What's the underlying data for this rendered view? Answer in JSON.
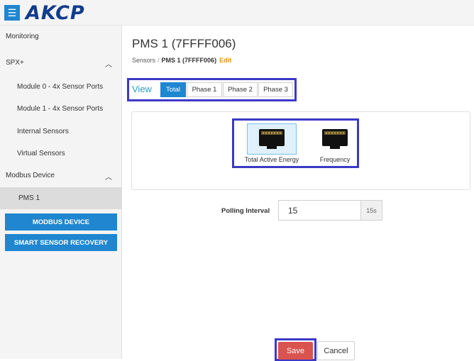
{
  "brand": {
    "logo": "AKCP",
    "menu_icon": "hamburger-icon",
    "accent": "#1f86cf"
  },
  "sidebar": {
    "items": [
      {
        "label": "Monitoring"
      },
      {
        "label": "SPX+",
        "chevron": "chevron-up-icon"
      },
      {
        "label": "Module 0 - 4x Sensor Ports"
      },
      {
        "label": "Module 1 - 4x Sensor Ports"
      },
      {
        "label": "Internal Sensors"
      },
      {
        "label": "Virtual Sensors"
      },
      {
        "label": "Modbus Device",
        "chevron": "chevron-up-icon"
      },
      {
        "label": "PMS 1"
      }
    ],
    "buttons": {
      "modbus": "MODBUS DEVICE",
      "recovery": "SMART SENSOR RECOVERY"
    }
  },
  "page": {
    "title": "PMS 1 (7FFFF006)",
    "breadcrumb": {
      "root": "Sensors",
      "sep": "/",
      "current": "PMS 1 (7FFFF006)",
      "edit": "Edit"
    }
  },
  "view": {
    "label": "View",
    "tabs": [
      {
        "label": "Total",
        "active": true
      },
      {
        "label": "Phase 1"
      },
      {
        "label": "Phase 2"
      },
      {
        "label": "Phase 3"
      }
    ]
  },
  "sensors": [
    {
      "label": "Total Active Energy",
      "icon": "rj45-port-icon",
      "selected": true
    },
    {
      "label": "Frequency",
      "icon": "rj45-port-icon"
    }
  ],
  "polling": {
    "label": "Polling Interval",
    "value": "15",
    "unit": "15s"
  },
  "actions": {
    "save": "Save",
    "cancel": "Cancel"
  },
  "colors": {
    "highlight": "#3c39c6",
    "save": "#d9534f",
    "edit": "#e8911c"
  }
}
